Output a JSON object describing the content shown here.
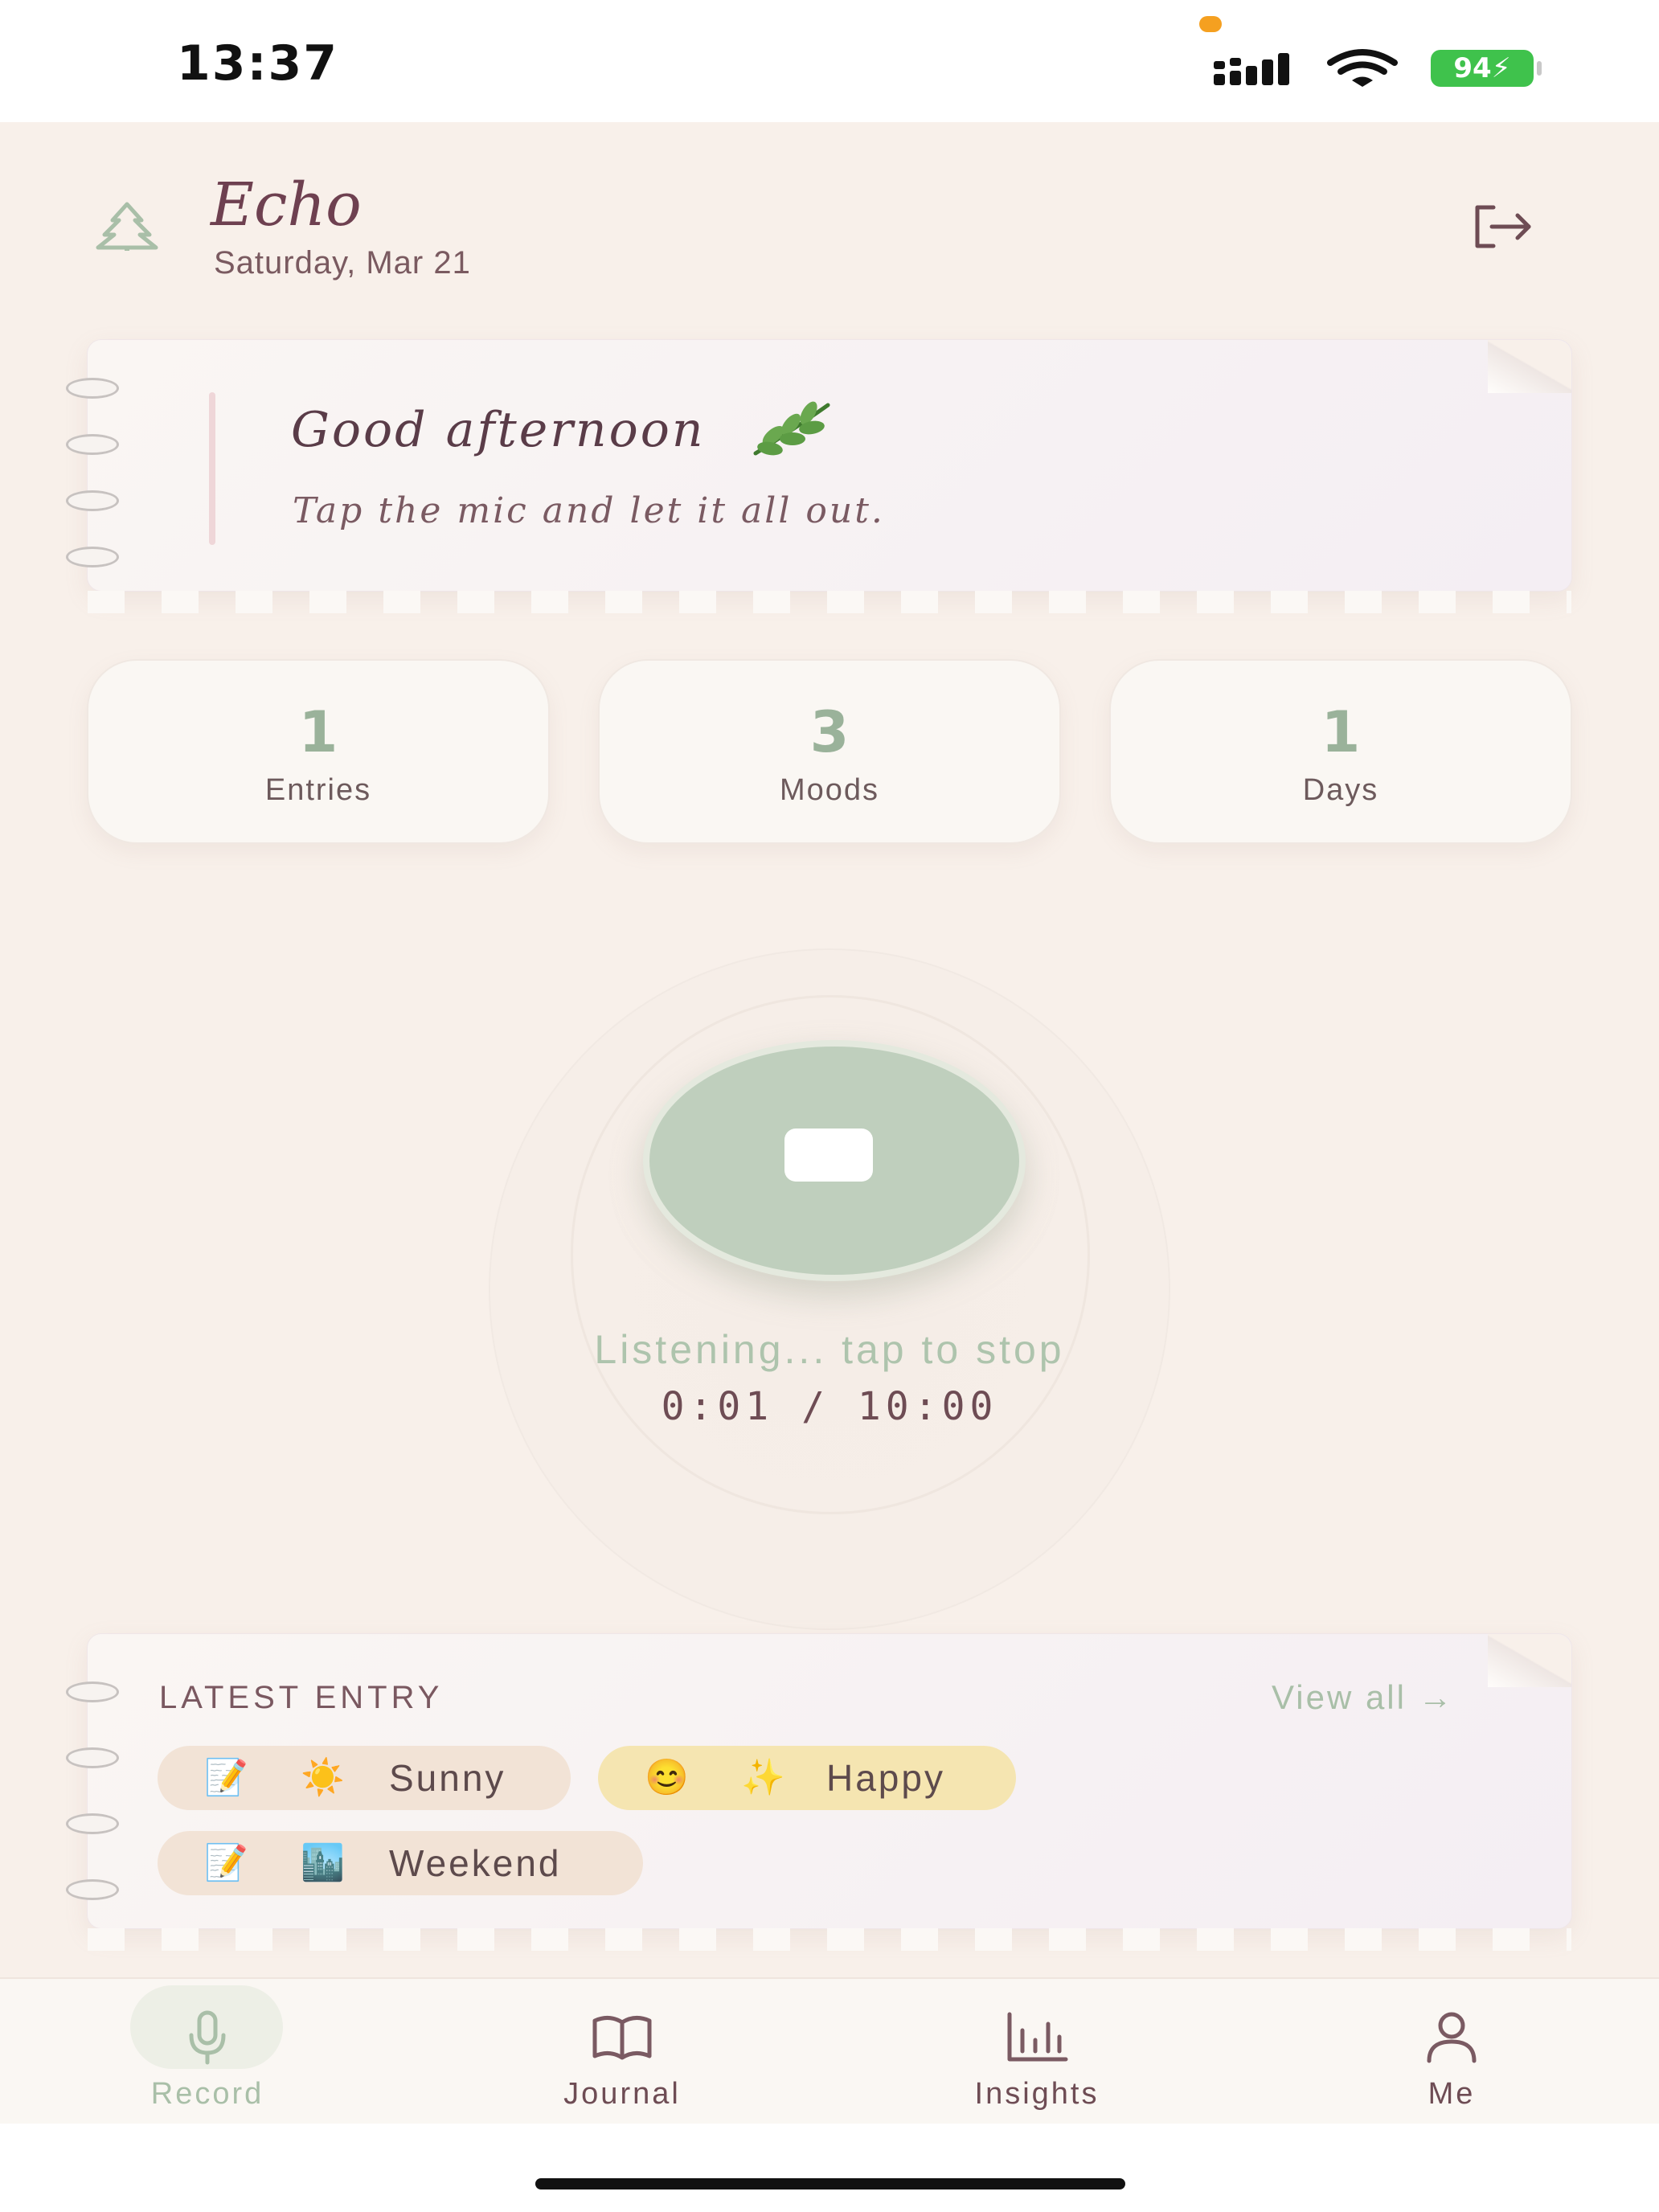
{
  "status_bar": {
    "time": "13:37",
    "battery": "94",
    "icons": [
      "signal-icon",
      "wifi-icon",
      "battery-charging-icon"
    ]
  },
  "header": {
    "app_name": "Echo",
    "date": "Saturday, Mar 21",
    "icons": [
      "tree-icon",
      "logout-icon"
    ]
  },
  "greeting_card": {
    "greeting": "Good afternoon",
    "subtitle": "Tap the mic and let it all out.",
    "icon": "herb-icon"
  },
  "stats": [
    {
      "value": "1",
      "label": "Entries"
    },
    {
      "value": "3",
      "label": "Moods"
    },
    {
      "value": "1",
      "label": "Days"
    }
  ],
  "recorder": {
    "status": "Listening... tap to stop",
    "timer": "0:01 / 10:00",
    "icon": "stop-icon",
    "accent_color": "#bfcfbd"
  },
  "latest_entry": {
    "title": "LATEST ENTRY",
    "view_all": "View all →",
    "tags": [
      {
        "emoji1": "📝",
        "emoji2": "☀️",
        "label": "Sunny"
      },
      {
        "emoji1": "😊",
        "emoji2": "✨",
        "label": "Happy"
      },
      {
        "emoji1": "📝",
        "emoji2": "🏙️",
        "label": "Weekend"
      }
    ]
  },
  "tab_bar": {
    "tabs": [
      {
        "label": "Record",
        "icon": "mic-icon",
        "active": true
      },
      {
        "label": "Journal",
        "icon": "book-icon",
        "active": false
      },
      {
        "label": "Insights",
        "icon": "bar-chart-icon",
        "active": false
      },
      {
        "label": "Me",
        "icon": "user-icon",
        "active": false
      }
    ]
  },
  "colors": {
    "background": "#f8f0ea",
    "accent_green": "#a9bfa8",
    "text_plum": "#6e4050"
  }
}
